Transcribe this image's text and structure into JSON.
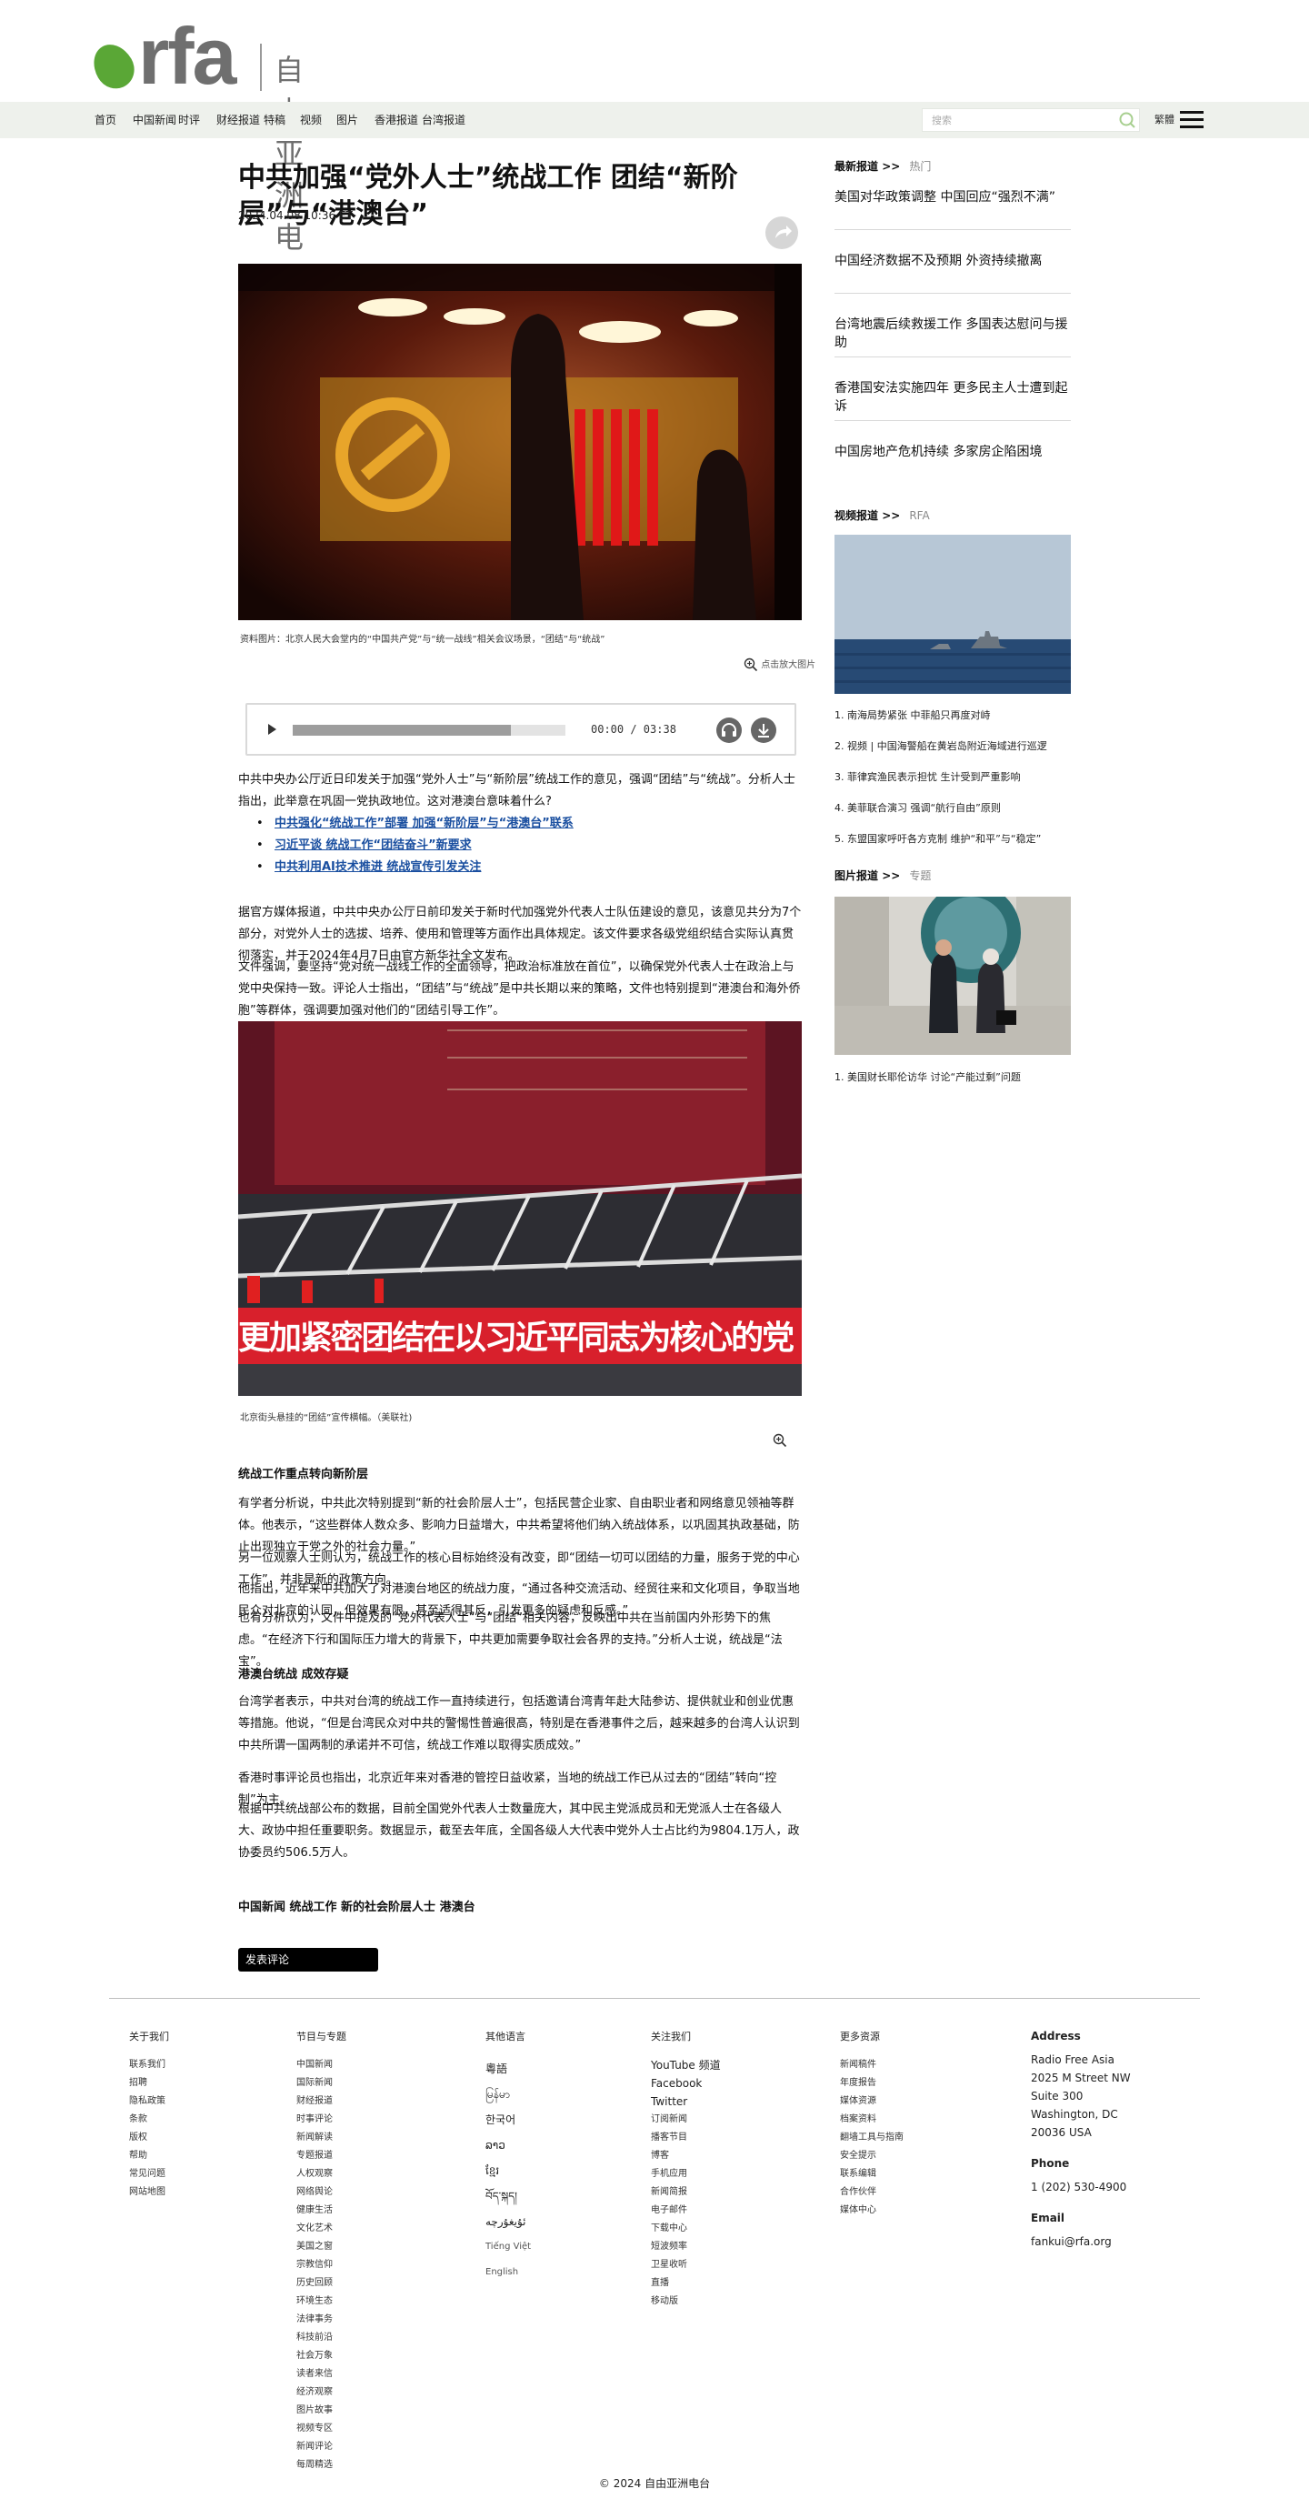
{
  "brand": {
    "logo_text": "rfa",
    "name_cn": "自由亚洲电台",
    "green": "#5aa736",
    "gray": "#6f6f6f"
  },
  "nav": {
    "items": [
      "首页",
      "中国新闻",
      "时评",
      "财经报道",
      "特稿",
      "视频",
      "图片",
      "香港报道",
      "台湾报道"
    ],
    "search_placeholder": "搜索",
    "lang": "繁體"
  },
  "article": {
    "title": "中共加强“党外人士”统战工作    团结“新阶层”与“港澳台”",
    "date": "2024.04.08 10:36 ET",
    "hero_caption": "资料图片：北京人民大会堂内的“中国共产党”与“统一战线”相关会议场景，“团结”与“统战”",
    "zoom_label": "点击放大图片",
    "player": {
      "time": "00:00 / 03:38",
      "progress": 0.8
    },
    "lead": "中共中央办公厅近日印发关于加强“党外人士”与“新阶层”统战工作的意见，强调“团结”与“统战”。分析人士指出，此举意在巩固一党执政地位。这对港澳台意味着什么?",
    "related": [
      "中共强化“统战工作”部署    加强“新阶层”与“港澳台”联系",
      "习近平谈    统战工作“团结奋斗”新要求",
      "中共利用AI技术推进 统战宣传引发关注"
    ],
    "para1": "据官方媒体报道，中共中央办公厅日前印发关于新时代加强党外代表人士队伍建设的意见，该意见共分为7个部分，对党外人士的选拔、培养、使用和管理等方面作出具体规定。该文件要求各级党组织结合实际认真贯彻落实，并于2024年4月7日由官方新华社全文发布。",
    "para2": "文件强调，要坚持“党对统一战线工作的全面领导，把政治标准放在首位”，以确保党外代表人士在政治上与党中央保持一致。评论人士指出，“团结”与“统战”是中共长期以来的策略，文件也特别提到“港澳台和海外侨胞”等群体，强调要加强对他们的“团结引导工作”。",
    "inline_caption": "北京街头悬挂的“团结”宣传横幅。（美联社)",
    "subhead1": "统战工作重点转向新阶层",
    "para3": "有学者分析说，中共此次特别提到“新的社会阶层人士”，包括民营企业家、自由职业者和网络意见领袖等群体。他表示，“这些群体人数众多、影响力日益增大，中共希望将他们纳入统战体系，以巩固其执政基础，防止出现独立于党之外的社会力量。”",
    "para4": "另一位观察人士则认为，统战工作的核心目标始终没有改变，即“团结一切可以团结的力量，服务于党的中心工作”，并非是新的政策方向。",
    "para5": "他指出，近年来中共加大了对港澳台地区的统战力度，“通过各种交流活动、经贸往来和文化项目，争取当地民众对北京的认同，但效果有限，甚至适得其反，引发更多的疑虑和反感。”",
    "para6": "也有分析认为，文件中提及的“党外代表人士”与“团结”相关内容，反映出中共在当前国内外形势下的焦虑。“在经济下行和国际压力增大的背景下，中共更加需要争取社会各界的支持。”分析人士说，统战是“法宝”。",
    "subhead2": "港澳台统战 成效存疑",
    "para7": "台湾学者表示，中共对台湾的统战工作一直持续进行，包括邀请台湾青年赴大陆参访、提供就业和创业优惠等措施。他说，“但是台湾民众对中共的警惕性普遍很高，特别是在香港事件之后，越来越多的台湾人认识到中共所谓一国两制的承诺并不可信，统战工作难以取得实质成效。”",
    "para8": "香港时事评论员也指出，北京近年来对香港的管控日益收紧，当地的统战工作已从过去的“团结”转向“控制”为主。",
    "para9": "根据中共统战部公布的数据，目前全国党外代表人士数量庞大，其中民主党派成员和无党派人士在各级人大、政协中担任重要职务。数据显示，截至去年底，全国各级人大代表中党外人士占比约为9804.1万人，政协委员约506.5万人。",
    "tags": "中国新闻 统战工作    新的社会阶层人士    港澳台",
    "black_button": "发表评论"
  },
  "sidebar": {
    "sec1_title": "最新报道",
    "sec1_sub": "热门",
    "sec1_links": [
      "美国对华政策调整  中国回应“强烈不满”",
      "中国经济数据不及预期    外资持续撤离",
      "台湾地震后续救援工作    多国表达慰问与援助",
      "香港国安法实施四年    更多民主人士遭到起诉",
      "中国房地产危机持续    多家房企陷困境"
    ],
    "sec2_title": "视频报道",
    "sec2_sub": "RFA",
    "sec2_list": [
      "1. 南海局势紧张 中菲船只再度对峙",
      "2. 视频 | 中国海警船在黄岩岛附近海域进行巡逻",
      "3. 菲律宾渔民表示担忧    生计受到严重影响",
      "4. 美菲联合演习    强调“航行自由”原则",
      "5. 东盟国家呼吁各方克制    维护“和平”与“稳定”"
    ],
    "sec3_title": "图片报道",
    "sec3_sub": "专题",
    "sec3_list": [
      "1. 美国财长耶伦访华 讨论“产能过剩”问题"
    ]
  },
  "footer": {
    "col1_title": "关于我们",
    "col1": [
      "联系我们",
      "招聘",
      "隐私政策",
      "条款",
      "版权",
      "帮助",
      "常见问题",
      "网站地图"
    ],
    "col2_title": "节目与专题",
    "col2": [
      "中国新闻",
      "国际新闻",
      "财经报道",
      "时事评论",
      "新闻解读",
      "专题报道",
      "人权观察",
      "网络舆论",
      "健康生活",
      "文化艺术",
      "美国之窗",
      "宗教信仰",
      "历史回顾",
      "环境生态",
      "法律事务",
      "科技前沿",
      "社会万象",
      "读者来信",
      "经济观察",
      "图片故事",
      "视频专区",
      "新闻评论",
      "每周精选"
    ],
    "col3_title": "其他语言",
    "col3": [
      "粵語",
      "မြန်မာ",
      "한국어",
      "ລາວ",
      "ខ្មែរ",
      "བོད་སྐད།",
      "ئۇيغۇرچە",
      "Tiếng Việt",
      "English"
    ],
    "col4_title": "关注我们",
    "col4_big": [
      "YouTube 频道",
      "Facebook",
      "Twitter"
    ],
    "col4": [
      "订阅新闻",
      "播客节目",
      "博客",
      "手机应用",
      "新闻简报",
      "电子邮件",
      "下载中心",
      "短波频率",
      "卫星收听",
      "直播",
      "移动版"
    ],
    "col5_title": "更多资源",
    "col5": [
      "新闻稿件",
      "年度报告",
      "媒体资源",
      "档案资料",
      "翻墙工具与指南",
      "安全提示",
      "联系编辑",
      "合作伙伴",
      "媒体中心"
    ],
    "address_title": "Address",
    "address": [
      "Radio Free Asia",
      "2025 M Street NW",
      "Suite 300",
      "Washington, DC",
      "20036 USA"
    ],
    "phone_title": "Phone",
    "phone": "1 (202) 530-4900",
    "email_title": "Email",
    "email": "fankui@rfa.org",
    "copyright": "© 2024 自由亚洲电台"
  }
}
